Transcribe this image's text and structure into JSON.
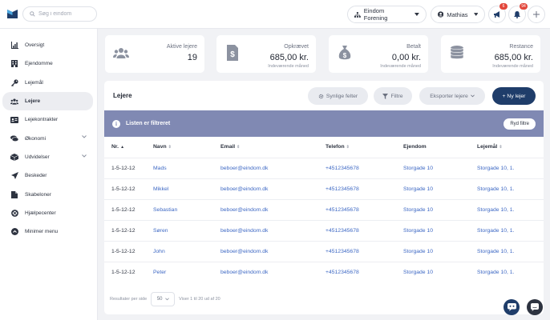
{
  "search": {
    "placeholder": "Søg i eindom"
  },
  "header": {
    "org_label": "Eindom Forening",
    "user_label": "Mathias",
    "megaphone_badge": "6",
    "bell_badge": "94"
  },
  "sidebar": {
    "items": [
      {
        "label": "Oversigt",
        "icon": "chart-icon"
      },
      {
        "label": "Ejendomme",
        "icon": "building-icon"
      },
      {
        "label": "Lejemål",
        "icon": "key-icon"
      },
      {
        "label": "Lejere",
        "icon": "users-icon"
      },
      {
        "label": "Lejekontrakter",
        "icon": "contract-icon"
      },
      {
        "label": "Økonomi",
        "icon": "coins-icon"
      },
      {
        "label": "Udvidelser",
        "icon": "box-icon"
      },
      {
        "label": "Beskeder",
        "icon": "send-icon"
      },
      {
        "label": "Skabeloner",
        "icon": "file-icon"
      },
      {
        "label": "Hjælpecenter",
        "icon": "lifebuoy-icon"
      },
      {
        "label": "Minimer menu",
        "icon": "collapse-icon"
      }
    ]
  },
  "stats": [
    {
      "label": "Aktive lejere",
      "value": "19",
      "sub": ""
    },
    {
      "label": "Opkrævet",
      "value": "685,00 kr.",
      "sub": "Indeværende måned"
    },
    {
      "label": "Betalt",
      "value": "0,00 kr.",
      "sub": "Indeværende måned"
    },
    {
      "label": "Restance",
      "value": "685,00 kr.",
      "sub": "Indeværende måned"
    }
  ],
  "panel": {
    "title": "Lejere",
    "visible_fields_btn": "Synlige felter",
    "filter_btn": "Filtre",
    "export_btn": "Eksporter lejere",
    "new_btn": "+ Ny lejer"
  },
  "filterbar": {
    "text": "Listen er filtreret",
    "clear_btn": "Ryd filtre"
  },
  "table": {
    "headers": [
      "Nr.",
      "Navn",
      "Email",
      "Telefon",
      "Ejendom",
      "Lejemål"
    ],
    "rows": [
      [
        "1-5-12-12",
        "Mads",
        "beboer@eindom.dk",
        "+4512345678",
        "Storgade 10",
        "Storgade 10, 1."
      ],
      [
        "1-5-12-12",
        "Mikkel",
        "beboer@eindom.dk",
        "+4512345678",
        "Storgade 10",
        "Storgade 10, 1."
      ],
      [
        "1-5-12-12",
        "Sebastian",
        "beboer@eindom.dk",
        "+4512345678",
        "Storgade 10",
        "Storgade 10, 1."
      ],
      [
        "1-5-12-12",
        "Søren",
        "beboer@eindom.dk",
        "+4512345678",
        "Storgade 10",
        "Storgade 10, 1."
      ],
      [
        "1-5-12-12",
        "John",
        "beboer@eindom.dk",
        "+4512345678",
        "Storgade 10",
        "Storgade 10, 1."
      ],
      [
        "1-5-12-12",
        "Peter",
        "beboer@eindom.dk",
        "+4512345678",
        "Storgade 10",
        "Storgade 10, 1."
      ]
    ]
  },
  "pagination": {
    "per_page_label": "Resultater per side",
    "per_page_value": "50",
    "summary": "Viser 1 til 20 ud af 20"
  },
  "colors": {
    "accent": "#1f3d6a",
    "filter_bar": "#8089b3",
    "link": "#3d68c4",
    "badge": "#e2473b"
  }
}
